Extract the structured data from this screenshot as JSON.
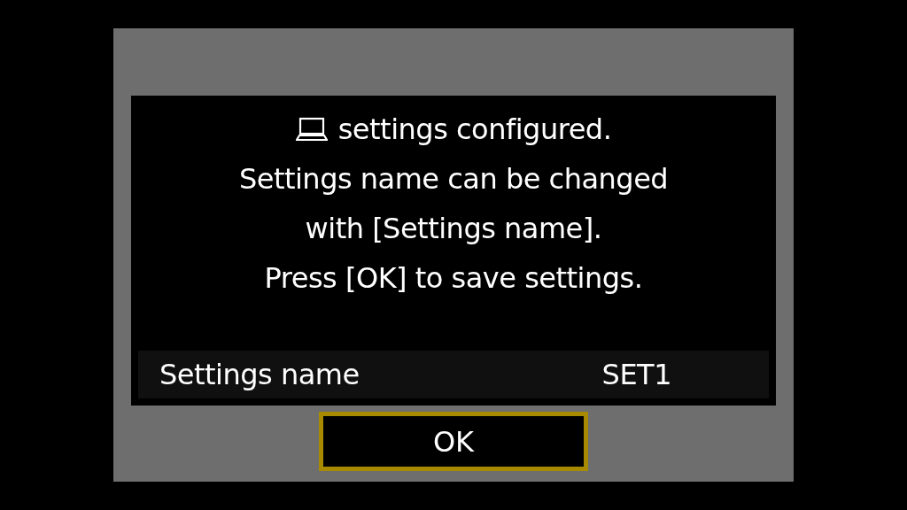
{
  "message": {
    "lines": [
      "settings configured.",
      "Settings name can be changed",
      "with [Settings name].",
      "Press [OK] to save settings."
    ]
  },
  "setting": {
    "label": "Settings name",
    "value": "SET1"
  },
  "button": {
    "label": "OK",
    "selected": true
  }
}
